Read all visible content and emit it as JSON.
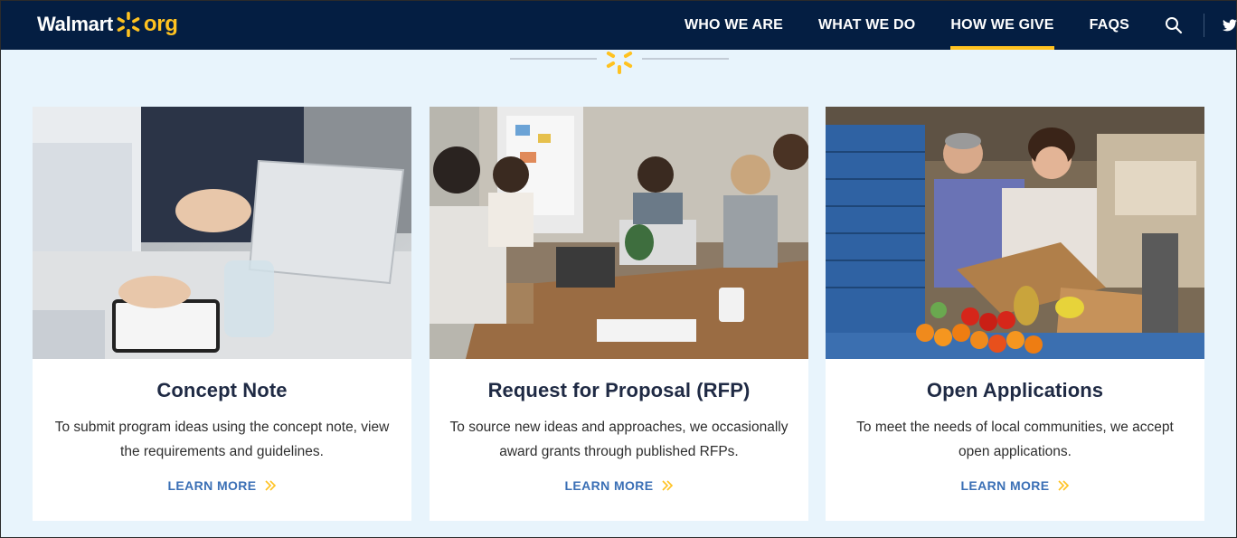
{
  "header": {
    "logo_word": "Walmart",
    "logo_suffix": "org",
    "nav": [
      {
        "label": "WHO WE ARE"
      },
      {
        "label": "WHAT WE DO"
      },
      {
        "label": "HOW WE GIVE"
      },
      {
        "label": "FAQS"
      }
    ],
    "active_index": 2,
    "icons": [
      "search-icon",
      "twitter-icon"
    ]
  },
  "cards": [
    {
      "title": "Concept Note",
      "description": "To submit program ideas using the concept note, view the requirements and guidelines.",
      "link": "LEARN MORE",
      "image": "meeting-tablet-photo"
    },
    {
      "title": "Request for Proposal (RFP)",
      "description": "To source new ideas and approaches, we occasionally award grants through published RFPs.",
      "link": "LEARN MORE",
      "image": "team-meeting-photo"
    },
    {
      "title": "Open Applications",
      "description": "To meet the needs of local communities, we accept open applications.",
      "link": "LEARN MORE",
      "image": "food-bank-produce-photo"
    }
  ],
  "colors": {
    "header_bg": "#041e42",
    "accent": "#ffc220",
    "link": "#3a6fb5",
    "page_bg": "#e8f4fc",
    "title": "#1f2a44"
  }
}
